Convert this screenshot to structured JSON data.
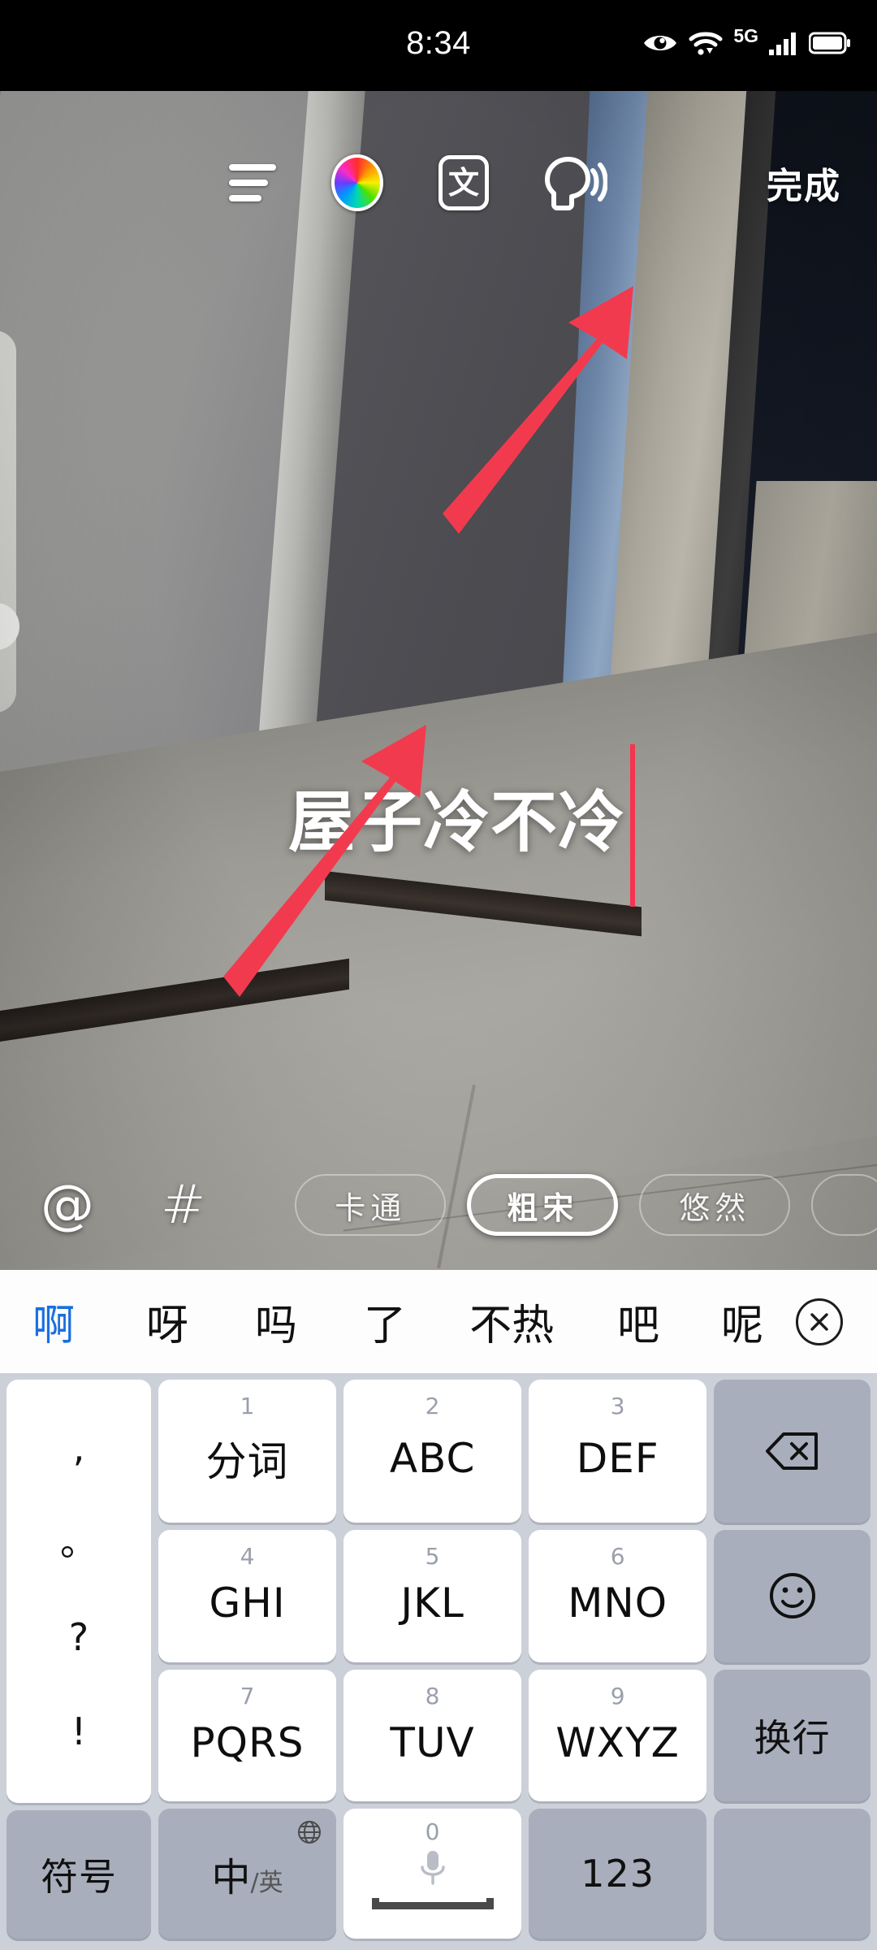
{
  "status_bar": {
    "time": "8:34",
    "icons": [
      "eye-care-icon",
      "wifi-icon",
      "5g-icon",
      "signal-icon",
      "battery-icon"
    ],
    "network_label": "5G"
  },
  "toolbar": {
    "align_label": "align-icon",
    "color_label": "color-wheel-icon",
    "text_style_label": "文",
    "tts_label": "text-to-speech-icon",
    "done_label": "完成"
  },
  "canvas": {
    "overlay_text": "屋子冷不冷",
    "caret_color": "#f5344f",
    "arrow_color": "#f23a4e"
  },
  "font_strip": {
    "mention_label": "@",
    "hashtag_label": "#",
    "fonts": [
      {
        "label": "卡通",
        "selected": false
      },
      {
        "label": "粗宋",
        "selected": true
      },
      {
        "label": "悠然",
        "selected": false
      },
      {
        "label": "",
        "selected": false
      }
    ]
  },
  "candidates": {
    "items": [
      "啊",
      "呀",
      "吗",
      "了",
      "不热",
      "吧",
      "呢"
    ],
    "active_index": 0,
    "close_label": "✕",
    "active_color": "#1a6fdd"
  },
  "keyboard": {
    "punctuation": [
      ",",
      "。",
      "?",
      "!"
    ],
    "rows": [
      [
        {
          "num": "1",
          "label": "分词"
        },
        {
          "num": "2",
          "label": "ABC"
        },
        {
          "num": "3",
          "label": "DEF"
        },
        {
          "num": "",
          "label": "backspace-icon",
          "fn": true
        }
      ],
      [
        {
          "num": "4",
          "label": "GHI"
        },
        {
          "num": "5",
          "label": "JKL"
        },
        {
          "num": "6",
          "label": "MNO"
        },
        {
          "num": "",
          "label": "emoji-icon",
          "fn": true
        }
      ],
      [
        {
          "num": "7",
          "label": "PQRS"
        },
        {
          "num": "8",
          "label": "TUV"
        },
        {
          "num": "9",
          "label": "WXYZ"
        },
        {
          "num": "",
          "label": "换行",
          "fn": true
        }
      ]
    ],
    "bottom": {
      "symbol_label": "符号",
      "lang_zh": "中",
      "lang_en": "/英",
      "globe_label": "globe-icon",
      "space_num": "0",
      "space_label": "space-mic-icon",
      "numeric_label": "123"
    }
  }
}
